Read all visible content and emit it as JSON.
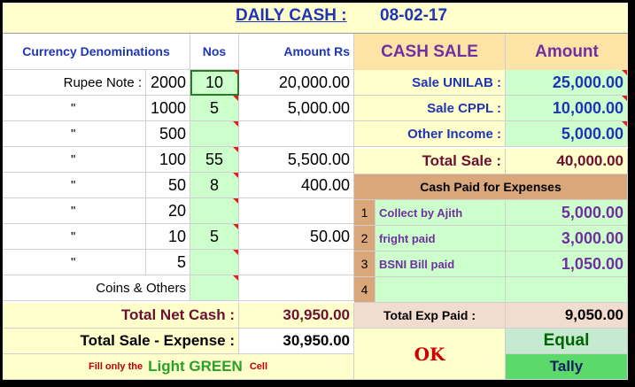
{
  "header": {
    "title": "DAILY CASH :",
    "date": "08-02-17"
  },
  "currency": {
    "col_denom": "Currency Denominations",
    "col_nos": "Nos",
    "col_amount": "Amount Rs",
    "rows": [
      {
        "label": "Rupee Note :",
        "value": "2000",
        "nos": "10",
        "amount": "20,000.00"
      },
      {
        "label": "\"",
        "value": "1000",
        "nos": "5",
        "amount": "5,000.00"
      },
      {
        "label": "\"",
        "value": "500",
        "nos": "",
        "amount": ""
      },
      {
        "label": "\"",
        "value": "100",
        "nos": "55",
        "amount": "5,500.00"
      },
      {
        "label": "\"",
        "value": "50",
        "nos": "8",
        "amount": "400.00"
      },
      {
        "label": "\"",
        "value": "20",
        "nos": "",
        "amount": ""
      },
      {
        "label": "\"",
        "value": "10",
        "nos": "5",
        "amount": "50.00"
      },
      {
        "label": "\"",
        "value": "5",
        "nos": "",
        "amount": ""
      },
      {
        "label": "Coins & Others",
        "value": "",
        "nos": "",
        "amount": ""
      }
    ],
    "total_net_cash_label": "Total Net Cash :",
    "total_net_cash_value": "30,950.00",
    "total_sale_expense_label": "Total Sale - Expense :",
    "total_sale_expense_value": "30,950.00",
    "note_prefix": "Fill only the",
    "note_highlight": "Light GREEN",
    "note_suffix": "Cell"
  },
  "sales": {
    "col_cash_sale": "CASH SALE",
    "col_amount": "Amount",
    "rows": [
      {
        "label": "Sale UNILAB :",
        "amount": "25,000.00"
      },
      {
        "label": "Sale CPPL :",
        "amount": "10,000.00"
      },
      {
        "label": "Other Income :",
        "amount": "5,000.00"
      }
    ],
    "total_sale_label": "Total Sale :",
    "total_sale_value": "40,000.00"
  },
  "expenses": {
    "header": "Cash Paid for Expenses",
    "rows": [
      {
        "num": "1",
        "label": "Collect by Ajith",
        "amount": "5,000.00"
      },
      {
        "num": "2",
        "label": "fright paid",
        "amount": "3,000.00"
      },
      {
        "num": "3",
        "label": "BSNI Bill paid",
        "amount": "1,050.00"
      },
      {
        "num": "4",
        "label": "",
        "amount": ""
      }
    ],
    "total_label": "Total Exp Paid :",
    "total_value": "9,050.00"
  },
  "status": {
    "ok": "OK",
    "equal": "Equal",
    "tally": "Tally"
  },
  "colors": {
    "header_blue": "#1f35b5",
    "purple": "#7030a0",
    "note_green": "#2aa02a",
    "ok_red": "#cc0000",
    "equal_green": "#006400"
  }
}
